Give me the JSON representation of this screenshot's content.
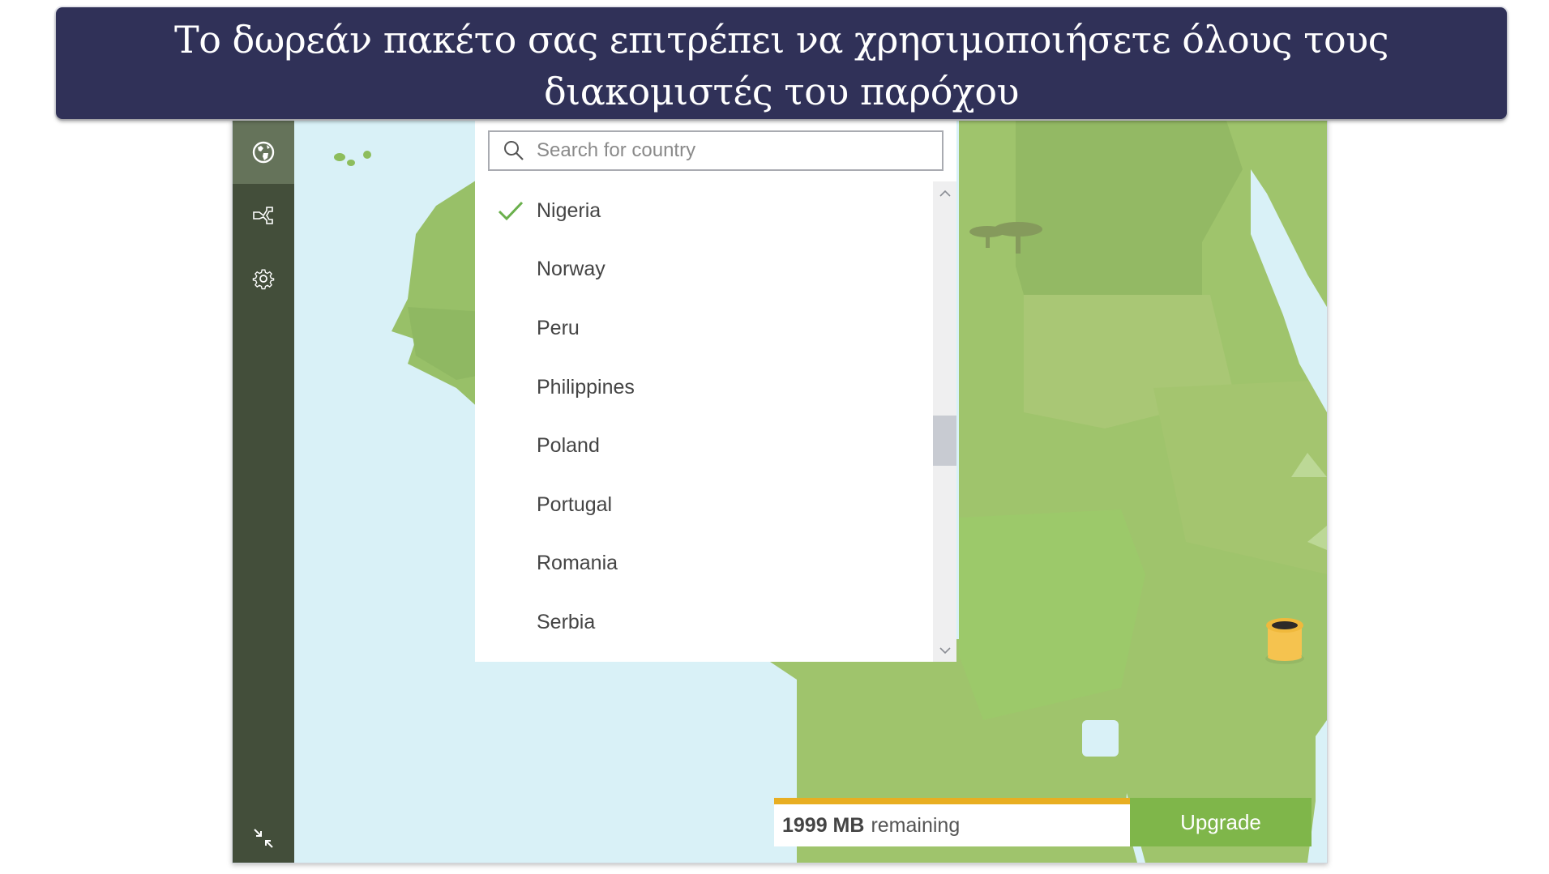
{
  "banner": {
    "text": "Το δωρεάν πακέτο σας επιτρέπει να χρησιμοποιήσετε όλους τους διακομιστές του παρόχου"
  },
  "sidebar": {
    "items": [
      {
        "name": "locations",
        "icon": "globe-icon",
        "active": true
      },
      {
        "name": "split-tunneling",
        "icon": "split-tunnel-icon",
        "active": false
      },
      {
        "name": "settings",
        "icon": "gear-icon",
        "active": false
      }
    ],
    "bottom_icon": "compress-icon"
  },
  "country_picker": {
    "search_placeholder": "Search for country",
    "search_value": "",
    "selected": "Nigeria",
    "countries": [
      "Nigeria",
      "Norway",
      "Peru",
      "Philippines",
      "Poland",
      "Portugal",
      "Romania",
      "Serbia"
    ],
    "scroll_position": 0.55
  },
  "data_usage": {
    "amount": "1999 MB",
    "suffix": "remaining"
  },
  "upgrade": {
    "label": "Upgrade"
  },
  "colors": {
    "banner_bg": "#303158",
    "sidebar_bg": "#434e3a",
    "sidebar_active": "#65735a",
    "check": "#6ab04c",
    "data_bar": "#e8ae22",
    "upgrade_bg": "#7fb64a",
    "water": "#d9f1f7"
  }
}
